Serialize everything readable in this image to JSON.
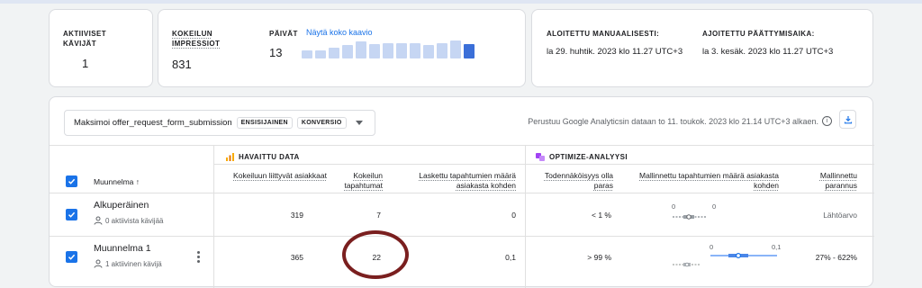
{
  "summary": {
    "active_users_label": "AKTIIVISET KÄVIJÄT",
    "active_users_value": "1",
    "impressions_label": "KOKEILUN IMPRESSIOT",
    "impressions_value": "831",
    "days_label": "PÄIVÄT",
    "days_value": "13",
    "view_chart_link": "Näytä koko kaavio",
    "daily_bars": [
      0.45,
      0.45,
      0.55,
      0.7,
      0.9,
      0.78,
      0.8,
      0.8,
      0.8,
      0.7,
      0.82,
      0.95,
      0.75
    ]
  },
  "schedule": {
    "manual_start_label": "ALOITETTU MANUAALISESTI:",
    "manual_start_value": "la 29. huhtik. 2023 klo 11.27 UTC+3",
    "scheduled_end_label": "AJOITETTU PÄÄTTYMISAIKA:",
    "scheduled_end_value": "la 3. kesäk. 2023 klo 11.27 UTC+3"
  },
  "toolbar": {
    "objective_text": "Maksimoi offer_request_form_submission",
    "chip_primary": "ENSISIJAINEN",
    "chip_conversion": "KONVERSIO",
    "data_note": "Perustuu Google Analyticsin dataan to 11. toukok. 2023 klo 21.14 UTC+3 alkaen."
  },
  "table": {
    "observed_header": "HAVAITTU DATA",
    "optimize_header": "OPTIMIZE-ANALYYSI",
    "variant_col": "Muunnelma",
    "sort_arrow": "↑",
    "col_users": "Kokeiluun liittyvät asiakkaat",
    "col_events": "Kokeilun tapahtumat",
    "col_events_per_user": "Laskettu tapahtumien määrä asiakasta kohden",
    "col_prob_best": "Todennäköisyys olla paras",
    "col_modeled": "Mallinnettu tapahtumien määrä asiakasta kohden",
    "col_improvement": "Mallinnettu parannus",
    "rows": [
      {
        "name": "Alkuperäinen",
        "sub": "0 aktiivista kävijää",
        "users": "319",
        "events": "7",
        "per_user": "0",
        "prob_best": "< 1 %",
        "axis_min": "0",
        "axis_max": "0",
        "improvement": "Lähtöarvo"
      },
      {
        "name": "Muunnelma 1",
        "sub": "1 aktiivinen kävijä",
        "users": "365",
        "events": "22",
        "per_user": "0,1",
        "prob_best": "> 99 %",
        "axis_min": "0",
        "axis_max": "0,1",
        "improvement": "27% - 622%"
      }
    ]
  },
  "colors": {
    "accent": "#1a73e8",
    "bar_light": "#c6d6f3",
    "bar_dark": "#3b6fd8",
    "annotation_circle": "#7a1f1f"
  }
}
